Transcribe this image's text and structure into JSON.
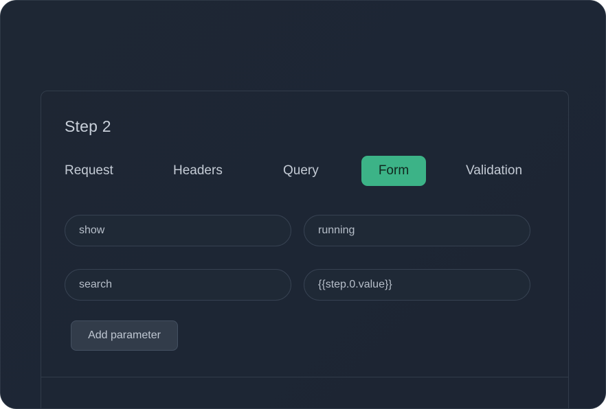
{
  "step": {
    "title": "Step 2"
  },
  "tabs": [
    {
      "label": "Request"
    },
    {
      "label": "Headers"
    },
    {
      "label": "Query"
    },
    {
      "label": "Form",
      "active": true
    },
    {
      "label": "Validation"
    }
  ],
  "params": [
    {
      "key": "show",
      "value": "running"
    },
    {
      "key": "search",
      "value": "{{step.0.value}}"
    }
  ],
  "actions": {
    "add_parameter": "Add parameter"
  },
  "colors": {
    "background": "#1e2734",
    "card_border": "#323c4a",
    "active_tab": "#3cb387",
    "text": "#c4cbd5"
  }
}
